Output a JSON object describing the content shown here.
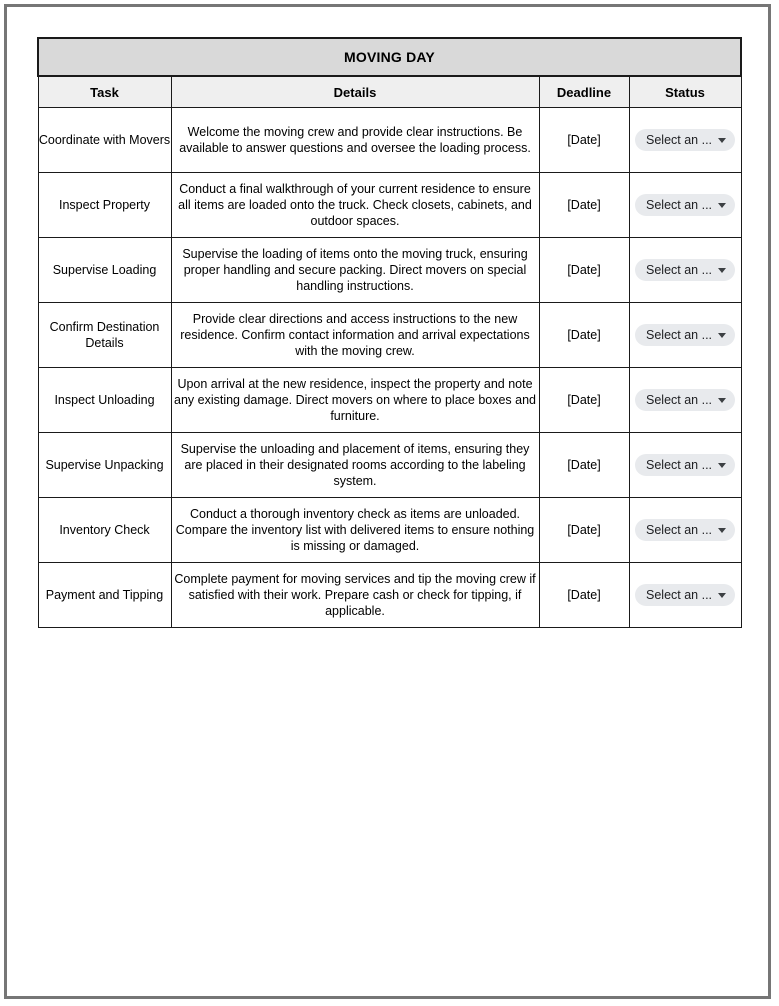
{
  "document": {
    "table_title": "MOVING DAY",
    "columns": [
      "Task",
      "Details",
      "Deadline",
      "Status"
    ],
    "status_control": {
      "label": "Select an ...",
      "caret_icon": "chevron-down-icon",
      "chip_bg": "#e8eaed"
    },
    "colors": {
      "title_band": "#d9d9d9",
      "header_band": "#efefef",
      "grid_line": "#1a1a1a",
      "page_border": "#767676"
    },
    "rows": [
      {
        "task": "Coordinate with Movers",
        "details": "Welcome the moving crew and provide clear instructions. Be available to answer questions and oversee the loading process.",
        "deadline": "[Date]",
        "status": "Select an ..."
      },
      {
        "task": "Inspect Property",
        "details": "Conduct a final walkthrough of your current residence to ensure all items are loaded onto the truck. Check closets, cabinets, and outdoor spaces.",
        "deadline": "[Date]",
        "status": "Select an ..."
      },
      {
        "task": "Supervise Loading",
        "details": "Supervise the loading of items onto the moving truck, ensuring proper handling and secure packing. Direct movers on special handling instructions.",
        "deadline": "[Date]",
        "status": "Select an ..."
      },
      {
        "task": "Confirm Destination Details",
        "details": "Provide clear directions and access instructions to the new residence. Confirm contact information and arrival expectations with the moving crew.",
        "deadline": "[Date]",
        "status": "Select an ..."
      },
      {
        "task": "Inspect Unloading",
        "details": "Upon arrival at the new residence, inspect the property and note any existing damage. Direct movers on where to place boxes and furniture.",
        "deadline": "[Date]",
        "status": "Select an ..."
      },
      {
        "task": "Supervise Unpacking",
        "details": "Supervise the unloading and placement of items, ensuring they are placed in their designated rooms according to the labeling system.",
        "deadline": "[Date]",
        "status": "Select an ..."
      },
      {
        "task": "Inventory Check",
        "details": "Conduct a thorough inventory check as items are unloaded. Compare the inventory list with delivered items to ensure nothing is missing or damaged.",
        "deadline": "[Date]",
        "status": "Select an ..."
      },
      {
        "task": "Payment and Tipping",
        "details": "Complete payment for moving services and tip the moving crew if satisfied with their work. Prepare cash or check for tipping, if applicable.",
        "deadline": "[Date]",
        "status": "Select an ..."
      }
    ]
  }
}
